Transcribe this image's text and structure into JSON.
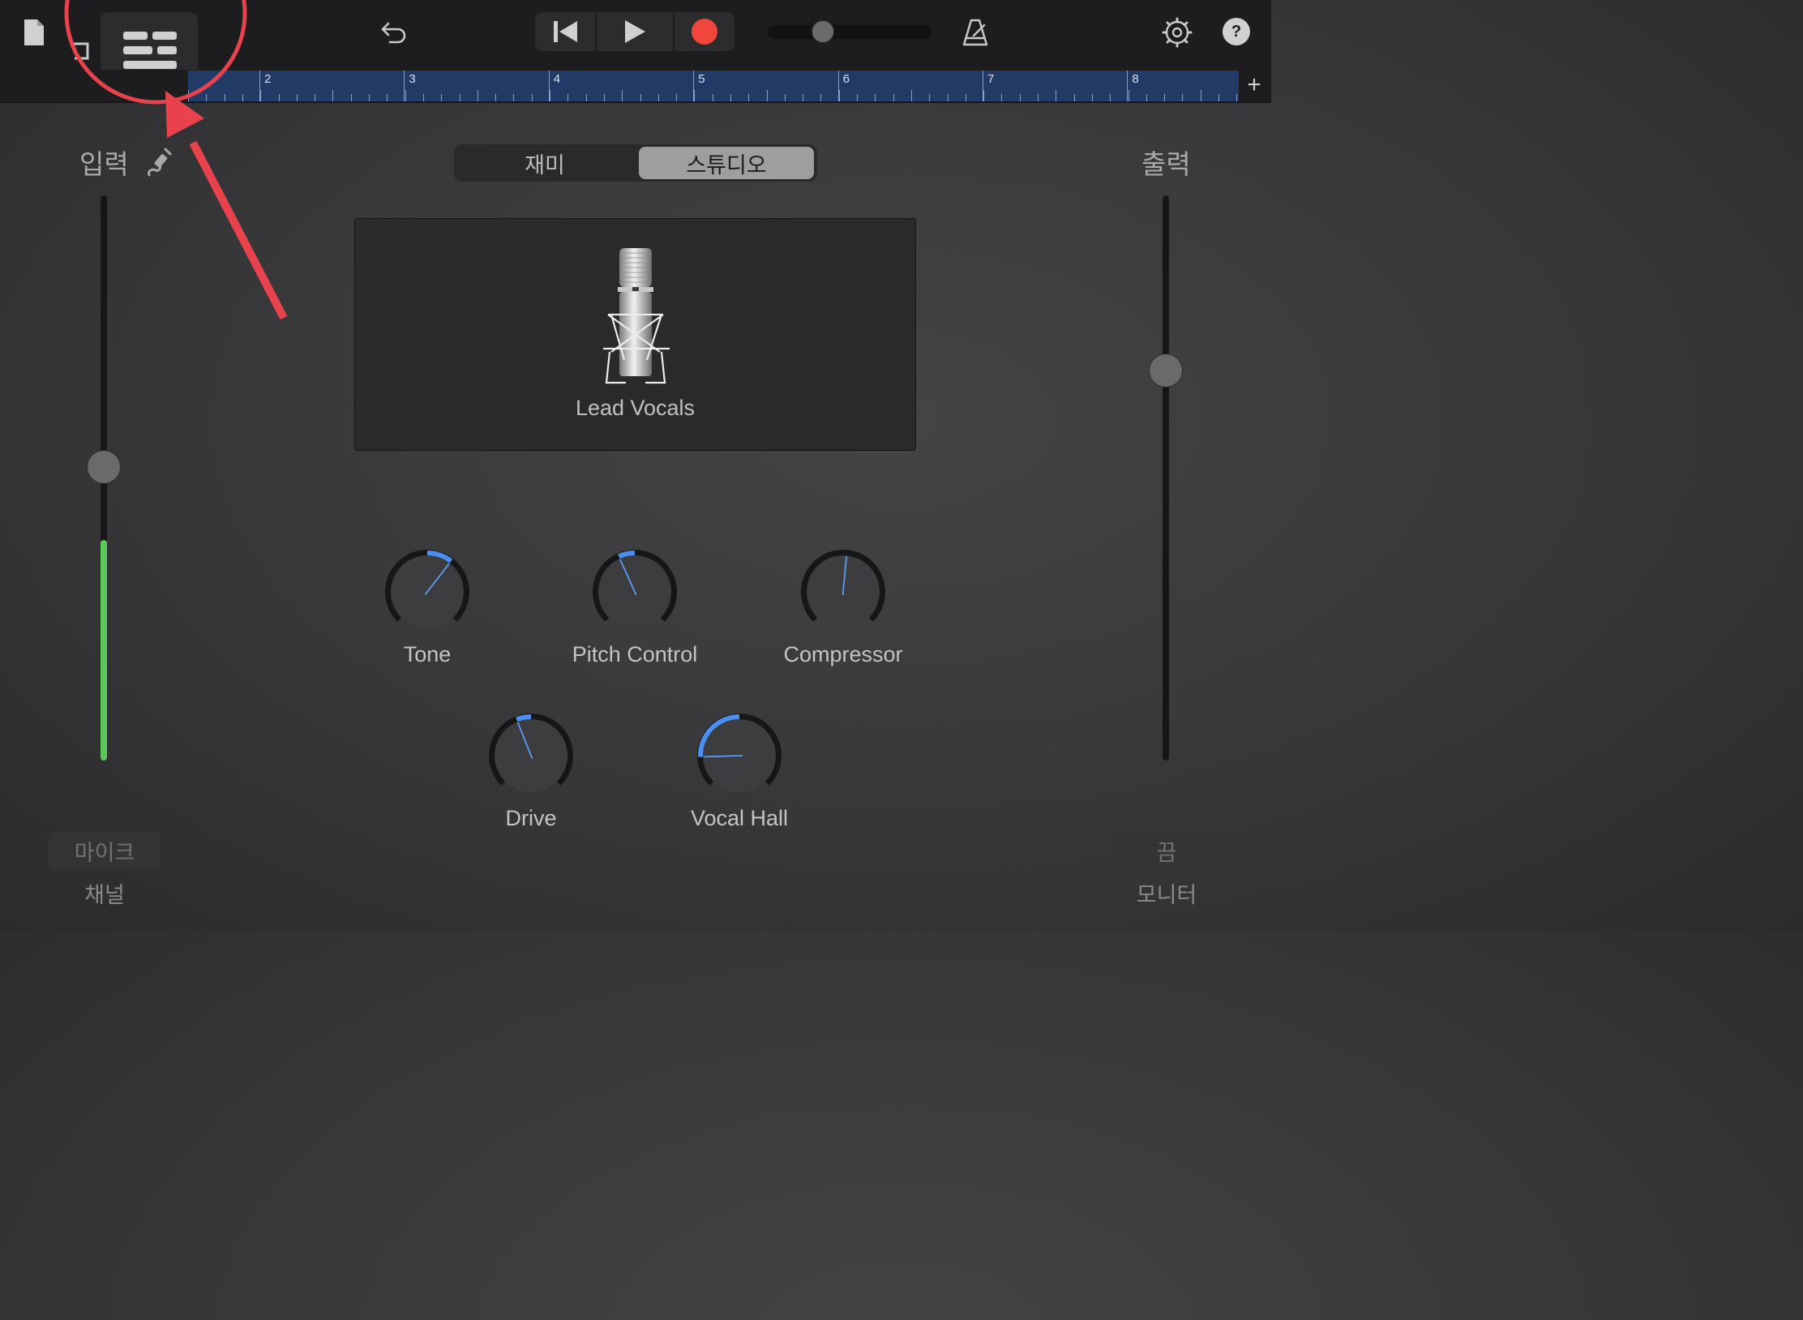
{
  "toolbar": {
    "icons": [
      "document-icon",
      "track-view-icon",
      "mixer-mode-icon",
      "undo-icon",
      "go-to-start-icon",
      "play-icon",
      "record-icon",
      "master-volume-slider",
      "metronome-icon",
      "settings-icon",
      "help-icon"
    ],
    "help_label": "?",
    "record_color": "#f0463c"
  },
  "ruler": {
    "bars": [
      "2",
      "3",
      "4",
      "5",
      "6",
      "7",
      "8"
    ],
    "add_label": "+"
  },
  "segmented": {
    "jam_label": "재미",
    "studio_label": "스튜디오",
    "selected": "스튜디오"
  },
  "input": {
    "title": "입력",
    "button_label": "마이크",
    "caption": "채널",
    "fader_level": 0.52,
    "meter_level": 0.39,
    "meter_color": "#5cc85a"
  },
  "output": {
    "title": "출력",
    "button_label": "끔",
    "caption": "모니터",
    "fader_level": 0.69
  },
  "preset": {
    "name": "Lead Vocals",
    "icon": "studio-microphone-icon"
  },
  "knobs": [
    {
      "label": "Tone",
      "value": 0.64
    },
    {
      "label": "Pitch Control",
      "value": 0.41
    },
    {
      "label": "Compressor",
      "value": 0.52
    },
    {
      "label": "Drive",
      "value": 0.42
    },
    {
      "label": "Vocal Hall",
      "value": 0.16
    }
  ],
  "annotation": {
    "color": "#e8434d"
  }
}
